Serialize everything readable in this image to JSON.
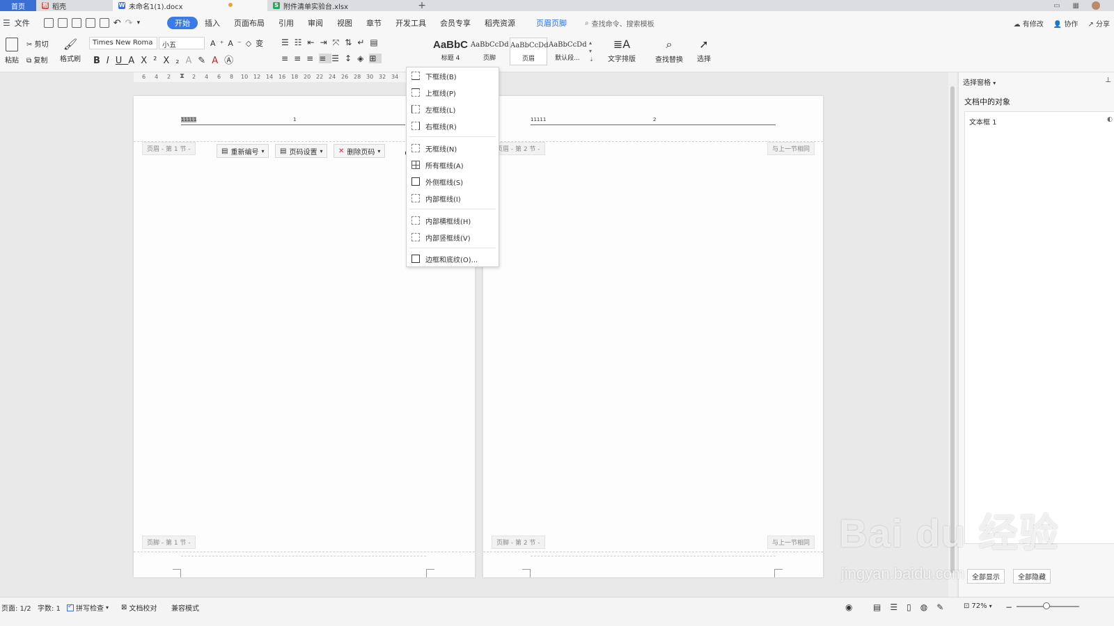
{
  "tabs": {
    "home": "首页",
    "daoke": "稻壳",
    "doc": "未命名1(1).docx",
    "xls": "附件清单实验台.xlsx",
    "add": "+"
  },
  "menu": {
    "file": "文件",
    "items": [
      "开始",
      "插入",
      "页面布局",
      "引用",
      "审阅",
      "视图",
      "章节",
      "开发工具",
      "会员专享",
      "稻壳资源"
    ],
    "header_footer": "页眉页脚",
    "search": "查找命令、搜索模板",
    "right": [
      "有修改",
      "协作",
      "分享"
    ]
  },
  "ribbon": {
    "paste": "粘贴",
    "cut": "剪切",
    "copy": "复制",
    "format_painter": "格式刷",
    "font_name": "Times New Roma",
    "font_size": "小五",
    "styles": [
      {
        "sample": "AaBbC",
        "name": "标题 4"
      },
      {
        "sample": "AaBbCcDd",
        "name": "页脚"
      },
      {
        "sample": "AaBbCcDd",
        "name": "页眉"
      },
      {
        "sample": "AaBbCcDd",
        "name": "默认段..."
      }
    ],
    "text_layout": "文字排版",
    "find_replace": "查找替换",
    "select": "选择"
  },
  "ruler": [
    "6",
    "4",
    "2",
    "2",
    "4",
    "6",
    "8",
    "10",
    "12",
    "14",
    "16",
    "18",
    "20",
    "22",
    "24",
    "26",
    "28",
    "30",
    "32",
    "34"
  ],
  "page1": {
    "header_text": "11111",
    "header_num": "1",
    "header_tag": "页眉 - 第 1 节 -",
    "renumber": "重新编号",
    "page_num_settings": "页码设置",
    "delete_page_num": "删除页码",
    "footer_tag": "页脚 - 第 1 节 -"
  },
  "page2": {
    "header_text": "11111",
    "header_num": "2",
    "header_tag": "页眉 - 第 2 节 -",
    "same_as_prev": "与上一节相同",
    "footer_tag": "页脚 - 第 2 节 -",
    "footer_same": "与上一节相同"
  },
  "border_menu": {
    "items": [
      {
        "label": "下框线(B)",
        "icon": "bottom-border-icon"
      },
      {
        "label": "上框线(P)",
        "icon": "top-border-icon"
      },
      {
        "label": "左框线(L)",
        "icon": "left-border-icon"
      },
      {
        "label": "右框线(R)",
        "icon": "right-border-icon"
      },
      {
        "label": "无框线(N)",
        "icon": "no-border-icon"
      },
      {
        "label": "所有框线(A)",
        "icon": "all-borders-icon"
      },
      {
        "label": "外侧框线(S)",
        "icon": "outside-borders-icon"
      },
      {
        "label": "内部框线(I)",
        "icon": "inside-borders-icon"
      },
      {
        "label": "内部横框线(H)",
        "icon": "inside-horizontal-border-icon"
      },
      {
        "label": "内部竖框线(V)",
        "icon": "inside-vertical-border-icon"
      },
      {
        "label": "边框和底纹(O)...",
        "icon": "borders-shading-icon"
      }
    ]
  },
  "right_panel": {
    "header": "选择窗格",
    "title": "文档中的对象",
    "object": "文本框 1",
    "show_all": "全部显示",
    "hide_all": "全部隐藏"
  },
  "status": {
    "page": "页面: 1/2",
    "word_count": "字数: 1",
    "spell_check": "拼写检查",
    "doc_proof": "文档校对",
    "compat_mode": "兼容模式",
    "zoom": "72%"
  },
  "watermark": {
    "brand": "Bai du 经验",
    "url": "jingyan.baidu.com"
  }
}
